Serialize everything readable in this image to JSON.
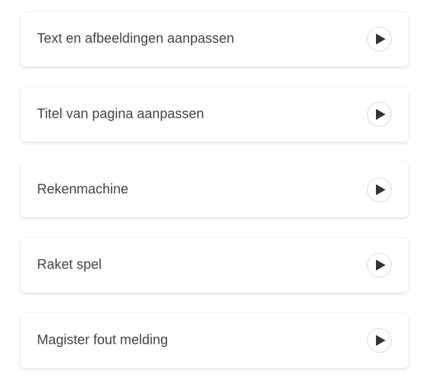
{
  "items": [
    {
      "label": "Text en afbeeldingen aanpassen",
      "icon": "play-icon"
    },
    {
      "label": "Titel van pagina aanpassen",
      "icon": "play-icon"
    },
    {
      "label": "Rekenmachine",
      "icon": "play-icon"
    },
    {
      "label": "Raket spel",
      "icon": "play-icon"
    },
    {
      "label": "Magister fout melding",
      "icon": "play-icon"
    }
  ],
  "colors": {
    "text": "#444444",
    "icon": "#333333",
    "button_border": "#d9d9d9"
  }
}
